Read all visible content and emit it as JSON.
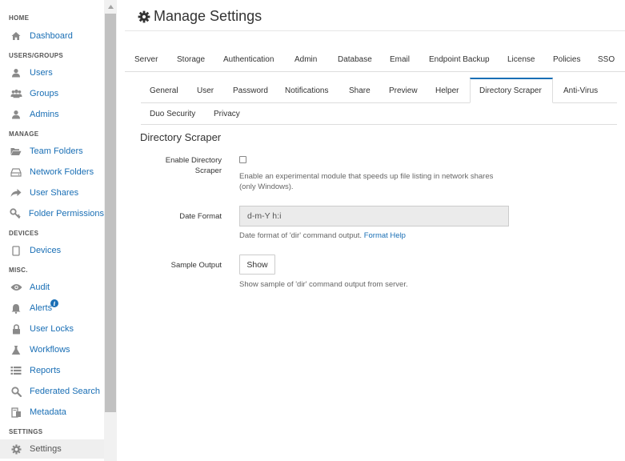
{
  "sidebar": {
    "sections": [
      {
        "key": "home",
        "header": "HOME",
        "items": [
          {
            "label": "Dashboard",
            "icon": "home-icon"
          }
        ]
      },
      {
        "key": "users",
        "header": "USERS/GROUPS",
        "items": [
          {
            "label": "Users",
            "icon": "user-icon"
          },
          {
            "label": "Groups",
            "icon": "groups-icon"
          },
          {
            "label": "Admins",
            "icon": "admin-icon"
          }
        ]
      },
      {
        "key": "manage",
        "header": "MANAGE",
        "items": [
          {
            "label": "Team Folders",
            "icon": "folder-open-icon"
          },
          {
            "label": "Network Folders",
            "icon": "hdd-icon"
          },
          {
            "label": "User Shares",
            "icon": "share-icon"
          },
          {
            "label": "Folder Permissions",
            "icon": "key-icon"
          }
        ]
      },
      {
        "key": "devices",
        "header": "DEVICES",
        "items": [
          {
            "label": "Devices",
            "icon": "tablet-icon"
          }
        ]
      },
      {
        "key": "misc",
        "header": "MISC.",
        "items": [
          {
            "label": "Audit",
            "icon": "eye-icon"
          },
          {
            "label": "Alerts",
            "icon": "bell-icon",
            "badge": "i"
          },
          {
            "label": "User Locks",
            "icon": "lock-icon"
          },
          {
            "label": "Workflows",
            "icon": "flask-icon"
          },
          {
            "label": "Reports",
            "icon": "list-icon"
          },
          {
            "label": "Federated Search",
            "icon": "search-icon"
          },
          {
            "label": "Metadata",
            "icon": "metadata-icon"
          }
        ]
      },
      {
        "key": "settings",
        "header": "SETTINGS",
        "items": [
          {
            "label": "Settings",
            "icon": "gear-icon",
            "active": true
          }
        ]
      }
    ]
  },
  "header": {
    "title": "Manage Settings",
    "icon": "gear-icon"
  },
  "tabs": [
    "Server",
    "Storage",
    "Authentication",
    "Admin",
    "Database",
    "Email",
    "Endpoint Backup",
    "License",
    "Policies",
    "SSO"
  ],
  "subtabs": [
    "General",
    "User",
    "Password",
    "Notifications",
    "Share",
    "Preview",
    "Helper",
    "Directory Scraper",
    "Anti-Virus",
    "Duo Security",
    "Privacy"
  ],
  "active_subtab": "Directory Scraper",
  "section": {
    "title": "Directory Scraper",
    "enable": {
      "label_line1": "Enable Directory",
      "label_line2": "Scraper",
      "help_line1": "Enable an experimental module that speeds up file listing in network shares",
      "help_line2": "(only Windows).",
      "checked": false
    },
    "date_format": {
      "label": "Date Format",
      "value": "d-m-Y h:i",
      "help": "Date format of 'dir' command output.",
      "help_link": "Format Help"
    },
    "sample_output": {
      "label": "Sample Output",
      "button": "Show",
      "help": "Show sample of 'dir' command output from server."
    }
  },
  "colors": {
    "link": "#1a6fb5",
    "active_tab_border": "#1a6fb5",
    "active_nav_bg": "#efefef"
  }
}
